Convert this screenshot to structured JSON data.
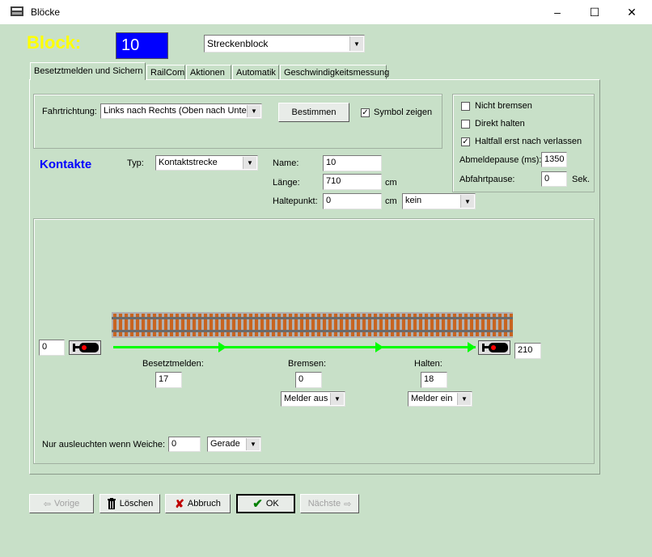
{
  "window": {
    "title": "Blöcke",
    "minimize": "–",
    "maximize": "☐",
    "close": "✕"
  },
  "header": {
    "block_label": "Block:",
    "block_number": "10",
    "block_type": "Streckenblock"
  },
  "tabs": [
    {
      "label": "Besetztmelden und Sichern"
    },
    {
      "label": "RailCom"
    },
    {
      "label": "Aktionen"
    },
    {
      "label": "Automatik"
    },
    {
      "label": "Geschwindigkeitsmessung"
    }
  ],
  "direction": {
    "label": "Fahrtrichtung:",
    "value": "Links nach Rechts (Oben nach Unten)",
    "determine_button": "Bestimmen",
    "show_symbol": {
      "label": "Symbol zeigen",
      "checked": "✓"
    }
  },
  "options": {
    "no_brake": {
      "label": "Nicht bremsen",
      "checked": ""
    },
    "direct_stop": {
      "label": "Direkt halten",
      "checked": ""
    },
    "stop_after_leave": {
      "label": "Haltfall erst nach verlassen",
      "checked": "✓"
    },
    "release_pause_label": "Abmeldepause (ms):",
    "release_pause_value": "1350",
    "departure_pause_label": "Abfahrtpause:",
    "departure_pause_value": "0",
    "departure_pause_unit": "Sek."
  },
  "contacts": {
    "heading": "Kontakte",
    "type_label": "Typ:",
    "type_value": "Kontaktstrecke",
    "name_label": "Name:",
    "name_value": "10",
    "length_label": "Länge:",
    "length_value": "710",
    "length_unit": "cm",
    "stop_label": "Haltepunkt:",
    "stop_value": "0",
    "stop_unit": "cm",
    "stop_select": "kein"
  },
  "track": {
    "left_value": "0",
    "right_value": "210",
    "occupied_label": "Besetztmelden:",
    "occupied_value": "17",
    "brake_label": "Bremsen:",
    "brake_value": "0",
    "brake_select": "Melder aus",
    "stop_label": "Halten:",
    "stop_value": "18",
    "stop_select": "Melder ein",
    "track_color": "#00ff00"
  },
  "switch": {
    "label": "Nur ausleuchten wenn Weiche:",
    "value": "0",
    "position": "Gerade"
  },
  "footer": {
    "prev": "Vorige",
    "delete": "Löschen",
    "cancel": "Abbruch",
    "ok": "OK",
    "next": "Nächste"
  },
  "colors": {
    "background": "#c8e0c8",
    "block_label": "#ffff00",
    "block_number_bg": "#0000ff",
    "contacts_heading": "#0000ff"
  }
}
